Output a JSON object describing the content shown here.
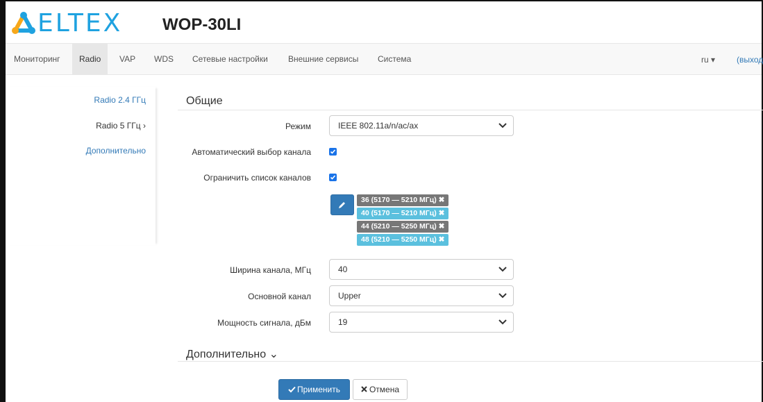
{
  "brand": {
    "logo_text": "ELTEX",
    "device": "WOP-30LI"
  },
  "colors": {
    "primary": "#337ab7",
    "tag_dark": "#777777",
    "tag_blue": "#5bc0de",
    "logo": "#1fa2e0"
  },
  "nav": {
    "items": [
      {
        "label": "Мониторинг"
      },
      {
        "label": "Radio"
      },
      {
        "label": "VAP"
      },
      {
        "label": "WDS"
      },
      {
        "label": "Сетевые настройки"
      },
      {
        "label": "Внешние сервисы"
      },
      {
        "label": "Система"
      }
    ],
    "active": "Radio",
    "lang": "ru ▾",
    "logout": "(выход"
  },
  "sidebar": {
    "items": [
      {
        "label": "Radio 2.4 ГГц"
      },
      {
        "label": "Radio 5 ГГц ›"
      },
      {
        "label": "Дополнительно"
      }
    ]
  },
  "general": {
    "title": "Общие",
    "mode": {
      "label": "Режим",
      "value": "IEEE 802.11a/n/ac/ax"
    },
    "auto_channel": {
      "label": "Автоматический выбор канала",
      "checked": true
    },
    "limit_channels": {
      "label": "Ограничить список каналов",
      "checked": true
    },
    "channels": [
      "36 (5170 — 5210 МГц) ✖",
      "40 (5170 — 5210 МГц) ✖",
      "44 (5210 — 5250 МГц) ✖",
      "48 (5210 — 5250 МГц) ✖"
    ],
    "bandwidth": {
      "label": "Ширина канала, МГц",
      "value": "40"
    },
    "primary_channel": {
      "label": "Основной канал",
      "value": "Upper"
    },
    "power": {
      "label": "Мощность сигнала, дБм",
      "value": "19"
    }
  },
  "advanced": {
    "title": "Дополнительно ⌄"
  },
  "actions": {
    "apply": "Применить",
    "cancel": "Отмена"
  },
  "icons": [
    "logo-icon",
    "pencil-icon",
    "check-icon",
    "close-icon",
    "chevron-down-icon"
  ]
}
